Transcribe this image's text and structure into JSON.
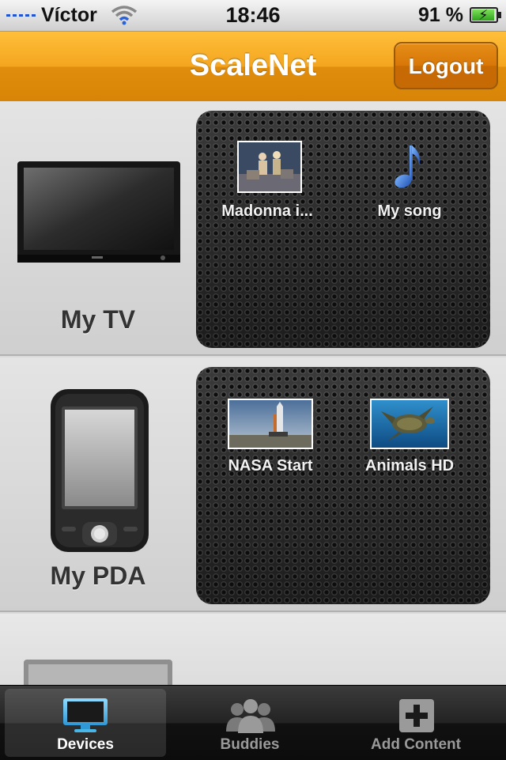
{
  "status": {
    "carrier": "Víctor",
    "time": "18:46",
    "battery": "91 %"
  },
  "nav": {
    "title": "ScaleNet",
    "logout_label": "Logout"
  },
  "devices": [
    {
      "name": "My TV",
      "items": [
        {
          "label": "Madonna i...",
          "type": "video"
        },
        {
          "label": "My song",
          "type": "music"
        }
      ]
    },
    {
      "name": "My PDA",
      "items": [
        {
          "label": "NASA Start",
          "type": "video"
        },
        {
          "label": "Animals HD",
          "type": "video"
        }
      ]
    }
  ],
  "tabs": [
    {
      "label": "Devices",
      "icon": "monitor-icon",
      "active": true
    },
    {
      "label": "Buddies",
      "icon": "people-icon",
      "active": false
    },
    {
      "label": "Add Content",
      "icon": "add-icon",
      "active": false
    }
  ],
  "colors": {
    "nav_orange": "#f4a51f",
    "tab_active_blue": "#49b6e8"
  }
}
